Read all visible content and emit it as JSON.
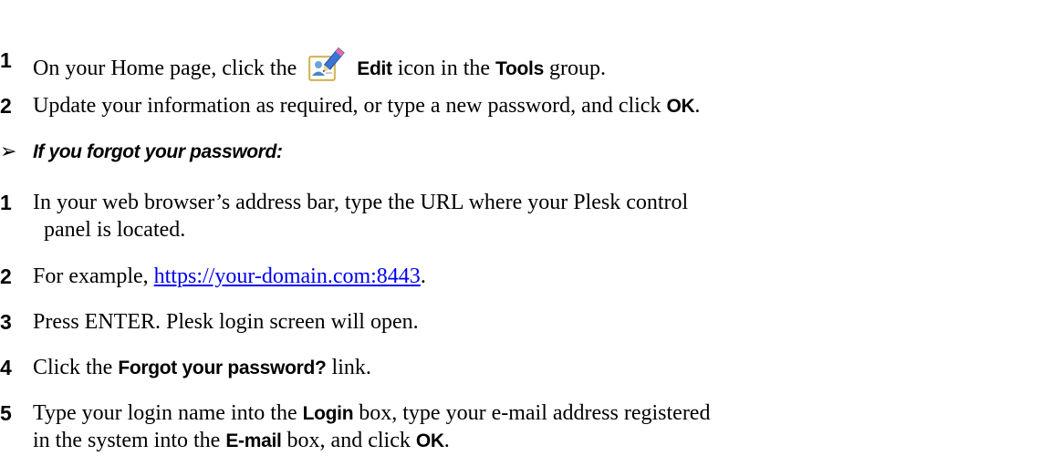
{
  "top_steps": [
    {
      "num": "1",
      "pre": "On your Home page, click the",
      "icon": "edit-icon",
      "ui1": "Edit",
      "mid": "icon in the",
      "ui2": "Tools",
      "post": "group."
    },
    {
      "num": "2",
      "pre": "Update your information as required, or type a new password, and click",
      "ui1": "OK",
      "post": "."
    }
  ],
  "forgot": {
    "arrow": "➢",
    "heading": "If you forgot your password:",
    "steps": [
      {
        "num": "1",
        "line1": "In your web browser’s address bar, type the URL where your Plesk control",
        "line2": "panel is located."
      },
      {
        "num": "2",
        "pre": "For example,",
        "link": "https://your-domain.com:8443",
        "post": "."
      },
      {
        "num": "3",
        "text": "Press ENTER. Plesk login screen will open."
      },
      {
        "num": "4",
        "pre": "Click the",
        "ui1": "Forgot your password?",
        "post": "link."
      },
      {
        "num": "5",
        "pre": "Type your login name into the",
        "ui1": "Login",
        "mid": "box, type your e-mail address registered",
        "line2_pre": "in the system into the",
        "ui2": "E-mail",
        "line2_mid": "box, and click",
        "ui3": "OK",
        "line2_post": "."
      }
    ]
  }
}
